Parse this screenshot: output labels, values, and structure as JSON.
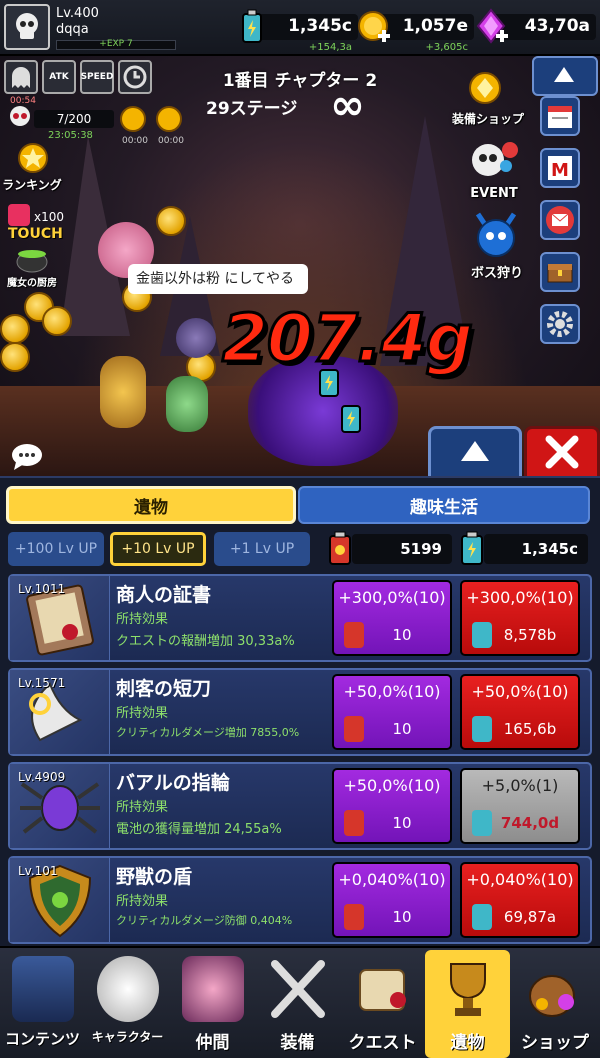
{
  "player": {
    "level": "Lv.400",
    "name": "dqqa",
    "exp": "+EXP 7"
  },
  "resources": [
    {
      "icon": "battery-icon",
      "value": "1,345c",
      "rate": "+154,3a"
    },
    {
      "icon": "gold-coin-plus-icon",
      "value": "1,057e",
      "rate": "+3,605c"
    },
    {
      "icon": "purple-gem-plus-icon",
      "value": "43,70a",
      "rate": ""
    }
  ],
  "buffs": [
    {
      "label": "",
      "time": "00:54"
    },
    {
      "label": "ATK",
      "time": ""
    },
    {
      "label": "SPEED",
      "time": ""
    },
    {
      "label": "",
      "time": ""
    }
  ],
  "party": {
    "count": "7/200",
    "timer": "23:05:38",
    "slot_times": [
      "00:00",
      "00:00"
    ]
  },
  "stage": {
    "chapter": "1番目 チャプター 2",
    "stage": "29ステージ",
    "loop": "∞"
  },
  "left_menu": {
    "ranking": "ランキング",
    "touch_count": "x100",
    "touch": "TOUCH",
    "kitchen": "魔女の厨房"
  },
  "right_menu": {
    "equip_shop": "装備ショップ",
    "event": "EVENT",
    "boss": "ボス狩り"
  },
  "speech": "金歯以外は粉 にしてやる",
  "damage": "207.4g",
  "tabs": {
    "relic": "遺物",
    "hobby": "趣味生活"
  },
  "lvup_buttons": [
    "+100 Lv UP",
    "+10 Lv UP",
    "+1 Lv UP"
  ],
  "currencies": {
    "relic_tickets": "5199",
    "batteries": "1,345c"
  },
  "relics": [
    {
      "level": "Lv.1011",
      "name": "商人の証書",
      "sub": "所持効果",
      "effect": "クエストの報酬増加 30,33a%",
      "buy1": {
        "pct": "+300,0%(10)",
        "cost": "10"
      },
      "buy2": {
        "pct": "+300,0%(10)",
        "cost": "8,578b",
        "state": "red"
      }
    },
    {
      "level": "Lv.1571",
      "name": "刺客の短刀",
      "sub": "所持効果",
      "effect": "クリティカルダメージ増加 7855,0%",
      "buy1": {
        "pct": "+50,0%(10)",
        "cost": "10"
      },
      "buy2": {
        "pct": "+50,0%(10)",
        "cost": "165,6b",
        "state": "red"
      }
    },
    {
      "level": "Lv.4909",
      "name": "バアルの指輪",
      "sub": "所持効果",
      "effect": "電池の獲得量増加 24,55a%",
      "buy1": {
        "pct": "+50,0%(10)",
        "cost": "10"
      },
      "buy2": {
        "pct": "+5,0%(1)",
        "cost": "744,0d",
        "state": "gray"
      }
    },
    {
      "level": "Lv.101",
      "name": "野獣の盾",
      "sub": "所持効果",
      "effect": "クリティカルダメージ防御 0,404%",
      "buy1": {
        "pct": "+0,040%(10)",
        "cost": "10"
      },
      "buy2": {
        "pct": "+0,040%(10)",
        "cost": "69,87a",
        "state": "red"
      }
    }
  ],
  "nav": [
    {
      "label": "コンテンツ",
      "icon": "castle-gate-icon"
    },
    {
      "label": "キャラクター",
      "icon": "skull-mask-icon"
    },
    {
      "label": "仲間",
      "icon": "witch-icon"
    },
    {
      "label": "装備",
      "icon": "crossed-swords-icon"
    },
    {
      "label": "クエスト",
      "icon": "scroll-quill-icon"
    },
    {
      "label": "遺物",
      "icon": "trophy-icon",
      "active": true
    },
    {
      "label": "ショップ",
      "icon": "treasure-bag-icon"
    }
  ],
  "colors": {
    "gold": "#ffd23a",
    "buy_purple": "#8a1fd0",
    "buy_red": "#d01515",
    "panel_blue": "#1c2a52",
    "green_text": "#8de06b"
  }
}
